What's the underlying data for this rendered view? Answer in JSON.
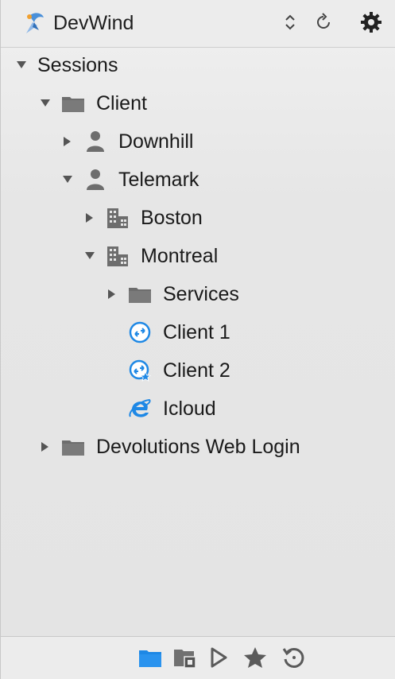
{
  "header": {
    "datasource_name": "DevWind",
    "datasource_icon": "devwind-datasource-icon",
    "buttons": [
      {
        "name": "switch-datasource-button",
        "icon": "up-down-chevron-icon"
      },
      {
        "name": "refresh-button",
        "icon": "refresh-icon"
      },
      {
        "name": "settings-button",
        "icon": "gear-icon"
      }
    ]
  },
  "tree": {
    "root": {
      "label": "Sessions",
      "expanded": true
    },
    "items": [
      {
        "label": "Client",
        "icon": "folder-icon",
        "expanded": true,
        "level": 1
      },
      {
        "label": "Downhill",
        "icon": "user-icon",
        "expanded": false,
        "level": 2
      },
      {
        "label": "Telemark",
        "icon": "user-icon",
        "expanded": true,
        "level": 2
      },
      {
        "label": "Boston",
        "icon": "building-icon",
        "expanded": false,
        "level": 3
      },
      {
        "label": "Montreal",
        "icon": "building-icon",
        "expanded": true,
        "level": 3
      },
      {
        "label": "Services",
        "icon": "folder-icon",
        "expanded": false,
        "level": 4
      },
      {
        "label": "Client 1",
        "icon": "remote-desktop-icon",
        "level": 4
      },
      {
        "label": "Client 2",
        "icon": "remote-desktop-favorite-icon",
        "level": 4
      },
      {
        "label": "Icloud",
        "icon": "internet-explorer-icon",
        "level": 4
      },
      {
        "label": "Devolutions Web Login",
        "icon": "folder-icon",
        "expanded": false,
        "level": 1
      }
    ]
  },
  "footer": {
    "buttons": [
      {
        "name": "navigation-tab",
        "icon": "folder-tab-icon",
        "active": true
      },
      {
        "name": "vault-tab",
        "icon": "vault-folder-icon",
        "active": false
      },
      {
        "name": "opened-sessions-tab",
        "icon": "play-icon",
        "active": false
      },
      {
        "name": "favorites-tab",
        "icon": "star-icon",
        "active": false
      },
      {
        "name": "recent-tab",
        "icon": "history-icon",
        "active": false
      }
    ]
  },
  "colors": {
    "accent": "#1e88e5",
    "text": "#1a1a1a",
    "icon_gray": "#6b6b6b"
  }
}
